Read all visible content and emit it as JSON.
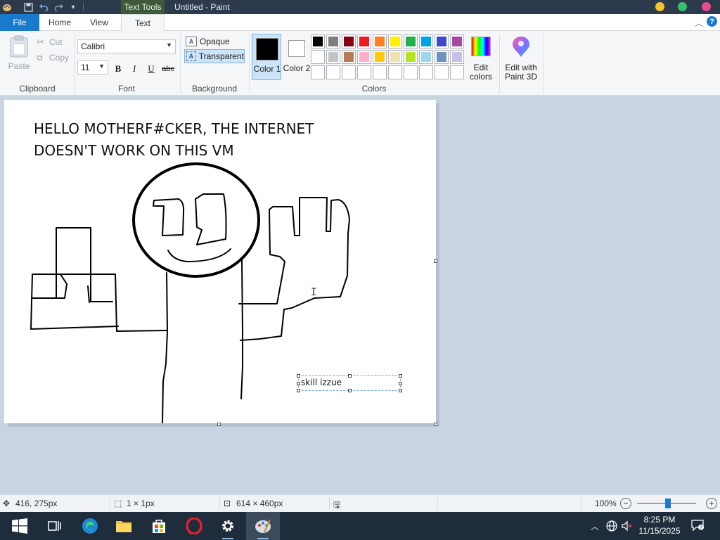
{
  "window": {
    "context_tab": "Text Tools",
    "title": "Untitled - Paint"
  },
  "tabs": {
    "file": "File",
    "home": "Home",
    "view": "View",
    "text": "Text"
  },
  "ribbon": {
    "clipboard": {
      "paste": "Paste",
      "cut": "Cut",
      "copy": "Copy",
      "label": "Clipboard"
    },
    "font": {
      "family": "Calibri",
      "size": "11",
      "bold": "B",
      "italic": "I",
      "underline": "U",
      "strike": "abc",
      "label": "Font"
    },
    "background": {
      "opaque": "Opaque",
      "transparent": "Transparent",
      "label": "Background"
    },
    "colors": {
      "color1_label": "Color 1",
      "color2_label": "Color 2",
      "color1_value": "#000000",
      "color2_value": "#ffffff",
      "label": "Colors",
      "edit_colors": "Edit colors",
      "edit_paint3d": "Edit with Paint 3D",
      "palette_row1": [
        "#000000",
        "#7f7f7f",
        "#880015",
        "#ed1c24",
        "#ff7f27",
        "#fff200",
        "#22b14c",
        "#00a2e8",
        "#3f48cc",
        "#a349a4"
      ],
      "palette_row2": [
        "#ffffff",
        "#c3c3c3",
        "#b97a57",
        "#ffaec9",
        "#ffc90e",
        "#efe4b0",
        "#b5e61d",
        "#99d9ea",
        "#7092be",
        "#c8bfe7"
      ],
      "palette_row3": [
        "",
        "",
        "",
        "",
        "",
        "",
        "",
        "",
        "",
        ""
      ]
    }
  },
  "canvas": {
    "text_line1": "HELLO MOTHERF#CKER, THE INTERNET",
    "text_line2": "DOESN'T WORK ON THIS VM",
    "textbox_text": "skill izzue"
  },
  "status": {
    "cursor_pos": "416, 275px",
    "selection_size": "1 × 1px",
    "canvas_size": "614 × 460px",
    "zoom": "100%"
  },
  "taskbar": {
    "time": "8:25 PM",
    "date": "11/15/2025"
  }
}
